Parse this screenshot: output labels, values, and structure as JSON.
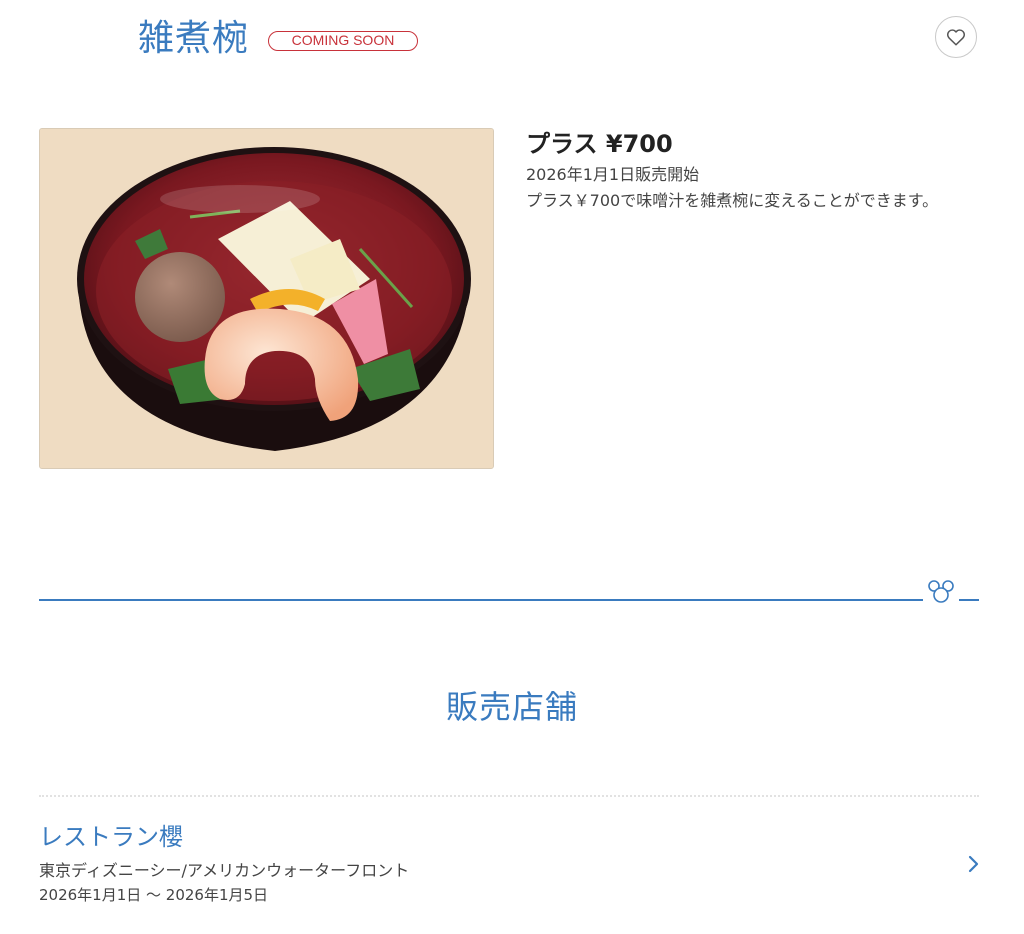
{
  "header": {
    "title": "雑煮椀",
    "badge": "COMING SOON",
    "favorite_icon": "heart-outline-icon"
  },
  "product": {
    "price": "プラス ¥700",
    "sale_start": "2026年1月1日販売開始",
    "description": "プラス￥700で味噌汁を雑煮椀に変えることができます。",
    "image_icon": "zoni-soup-bowl-photo"
  },
  "colors": {
    "accent": "#3a7bbf",
    "badge": "#c8323a"
  },
  "stores": {
    "section_title": "販売店舗",
    "items": [
      {
        "name": "レストラン櫻",
        "location": "東京ディズニーシー/アメリカンウォーターフロント",
        "period": "2026年1月1日 〜 2026年1月5日"
      }
    ]
  }
}
